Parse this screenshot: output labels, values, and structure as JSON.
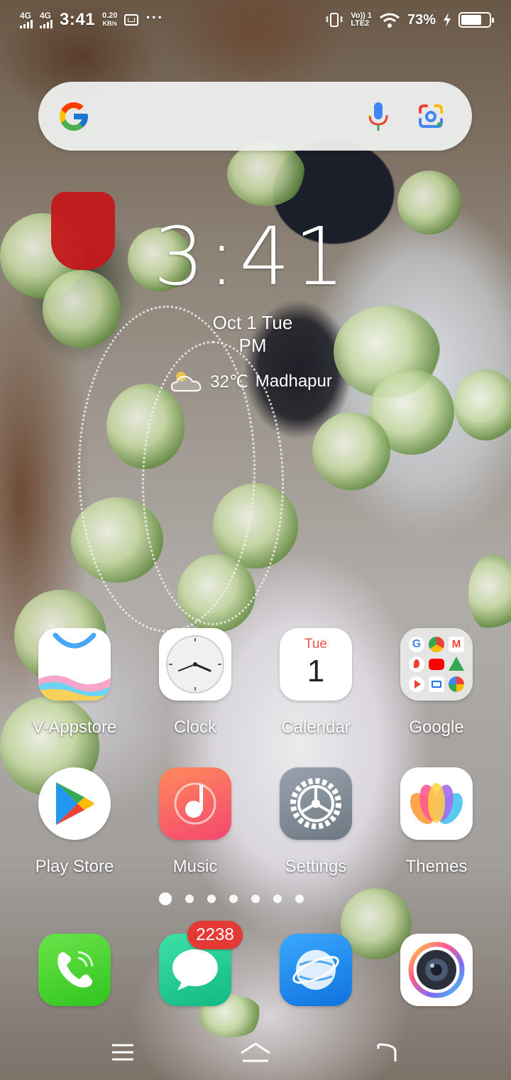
{
  "status_bar": {
    "sim1": "4G",
    "sim2": "4G",
    "time": "3:41",
    "speed_value": "0.20",
    "speed_unit": "KB/s",
    "more": "···",
    "volte_top": "Vo)) 1",
    "volte_bottom": "LTE2",
    "battery_percent": "73%",
    "battery_level": 0.73
  },
  "search": {
    "placeholder": ""
  },
  "clock_widget": {
    "time": "3:41",
    "date": "Oct 1  Tue",
    "ampm": "PM",
    "temperature": "32℃",
    "location": "Madhapur"
  },
  "apps_row1": [
    {
      "label": "V-Appstore"
    },
    {
      "label": "Clock"
    },
    {
      "label": "Calendar",
      "day": "Tue",
      "date": "1"
    },
    {
      "label": "Google"
    }
  ],
  "apps_row2": [
    {
      "label": "Play Store"
    },
    {
      "label": "Music"
    },
    {
      "label": "Settings"
    },
    {
      "label": "Themes"
    }
  ],
  "dock": {
    "messages_badge": "2238"
  },
  "page_indicator": {
    "count": 7,
    "active": 0
  },
  "colors": {
    "badge_red": "#e53935",
    "phone_green": "#3fd32b",
    "messages_green": "#22c98a",
    "browser_blue": "#1e8ff0",
    "music_pink": "#f55a7a"
  }
}
